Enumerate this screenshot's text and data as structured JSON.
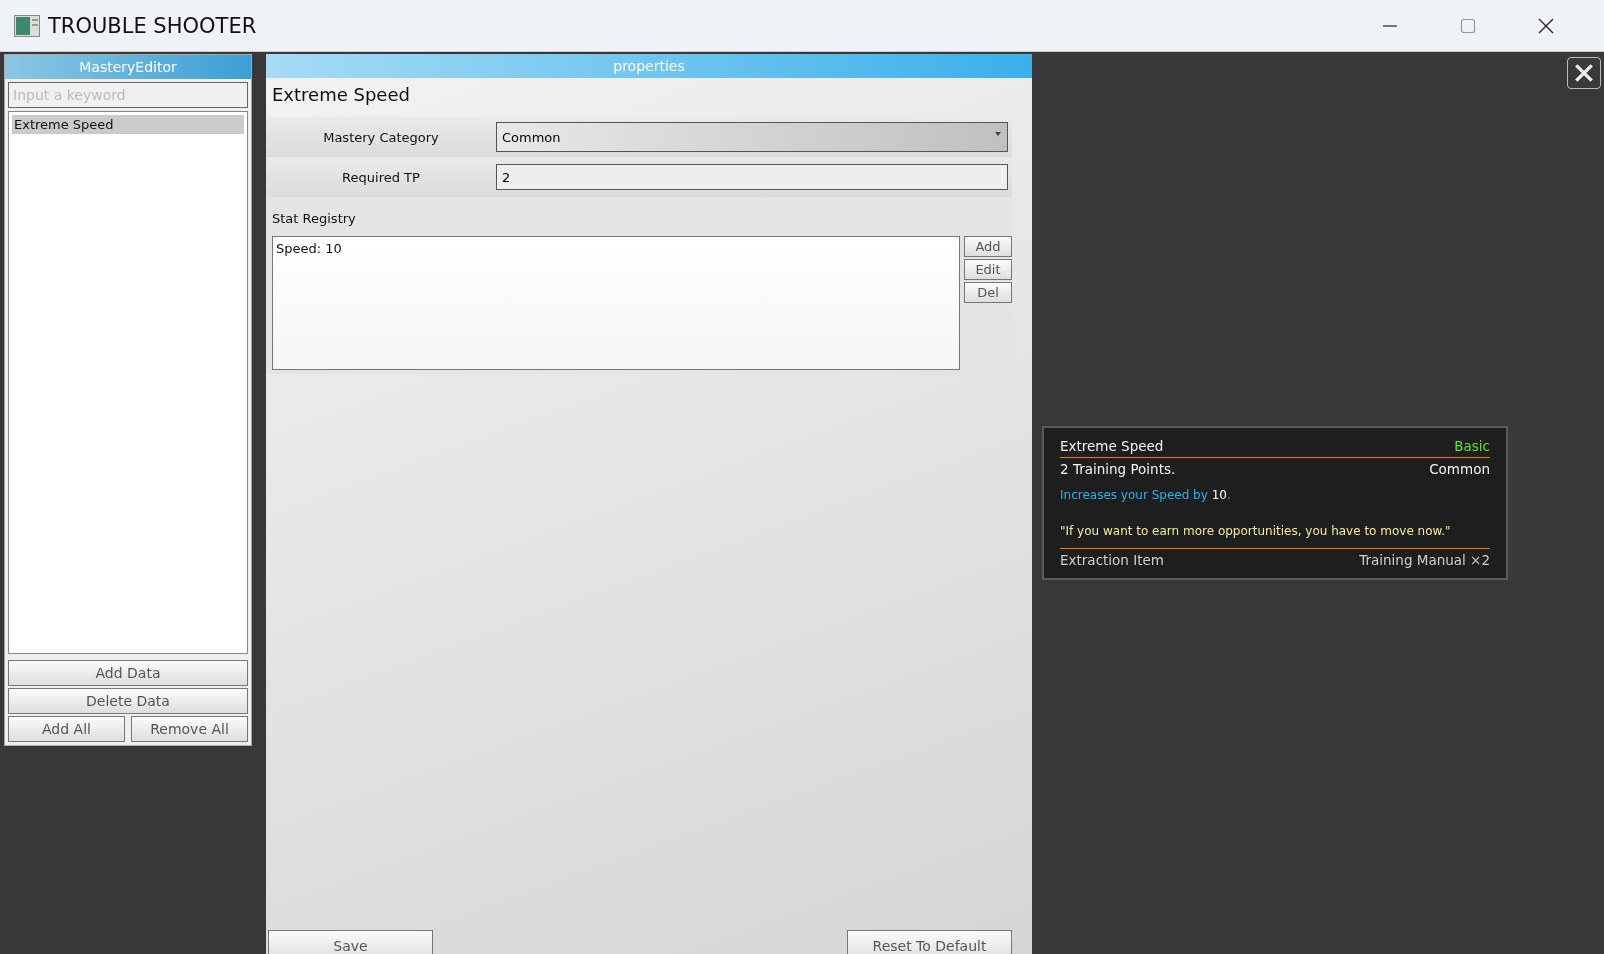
{
  "window": {
    "title": "TROUBLE SHOOTER"
  },
  "editor": {
    "title": "MasteryEditor",
    "search": {
      "placeholder": "Input a keyword"
    },
    "items": [
      {
        "label": "Extreme Speed",
        "selected": true
      }
    ],
    "buttons": [
      "Add Data",
      "Delete Data"
    ],
    "bottom_buttons": [
      "Add All",
      "Remove All"
    ]
  },
  "properties": {
    "title": "properties",
    "name": "Extreme Speed",
    "fields": [
      {
        "kind": "dropdown",
        "label": "Mastery Category",
        "value": "Common"
      },
      {
        "kind": "text",
        "label": "Required TP",
        "value": "2"
      }
    ],
    "stat_registry": {
      "label": "Stat Registry",
      "entries": [
        "Speed: 10"
      ],
      "buttons": [
        "Add",
        "Edit",
        "Del"
      ]
    },
    "save": "Save",
    "reset": "Reset To Default"
  },
  "tooltip": {
    "name": "Extreme Speed",
    "grade": "Basic",
    "cost": "2 Training Points.",
    "category": "Common",
    "description": "Increases your Speed by **10**.",
    "quote": "\"If you want to earn more opportunities, you have to move now.\"",
    "extraction_label": "Extraction Item",
    "extraction_value": "Training Manual ×2"
  }
}
